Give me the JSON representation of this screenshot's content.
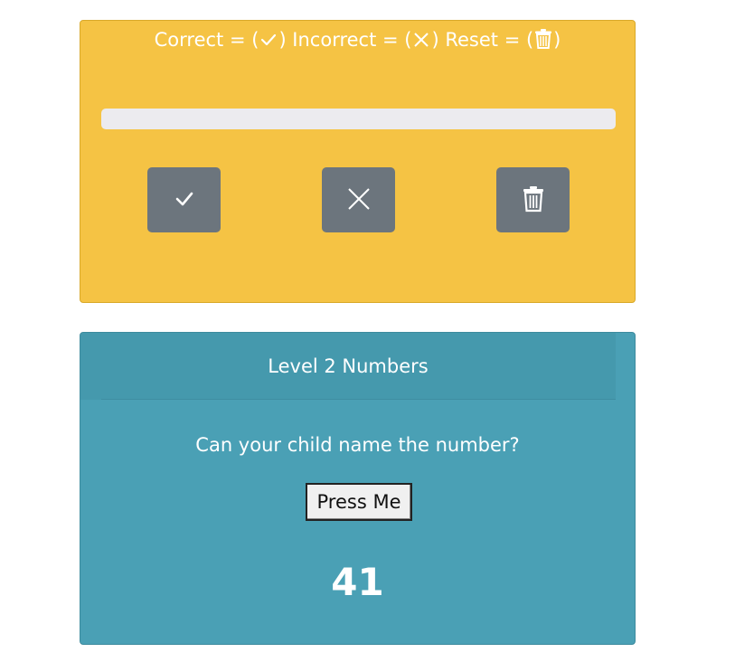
{
  "legend": {
    "correct_text": "Correct = (",
    "incorrect_text": ") Incorrect = (",
    "reset_text": ") Reset = (",
    "close_paren": ")",
    "icons": [
      "check-icon",
      "x-icon",
      "trash-icon"
    ]
  },
  "progress": {
    "value_fraction": 0
  },
  "actions": {
    "correct_icon": "check-icon",
    "incorrect_icon": "x-icon",
    "reset_icon": "trash-icon"
  },
  "quiz": {
    "title": "Level 2 Numbers",
    "question": "Can your child name the number?",
    "button_label": "Press Me",
    "number": "41"
  },
  "colors": {
    "yellow_card": "#f5c344",
    "teal_card": "#4aa0b5",
    "button_gray": "#6c757d",
    "progress_track": "#ecebef"
  }
}
